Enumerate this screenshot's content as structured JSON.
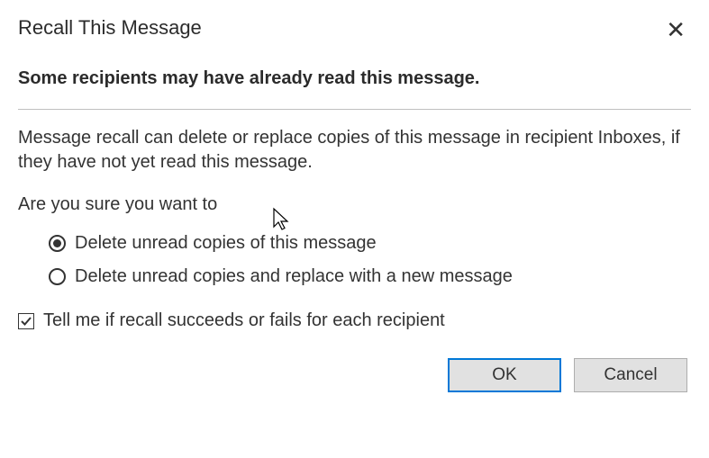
{
  "dialog": {
    "title": "Recall This Message",
    "heading": "Some recipients may have already read this message.",
    "description": "Message recall can delete or replace copies of this message in recipient Inboxes, if they have not yet read this message.",
    "prompt": "Are you sure you want to",
    "options": {
      "delete": "Delete unread copies of this message",
      "replace": "Delete unread copies and replace with a new message",
      "selected": "delete"
    },
    "checkbox": {
      "label": "Tell me if recall succeeds or fails for each recipient",
      "checked": true
    },
    "buttons": {
      "ok": "OK",
      "cancel": "Cancel"
    }
  }
}
